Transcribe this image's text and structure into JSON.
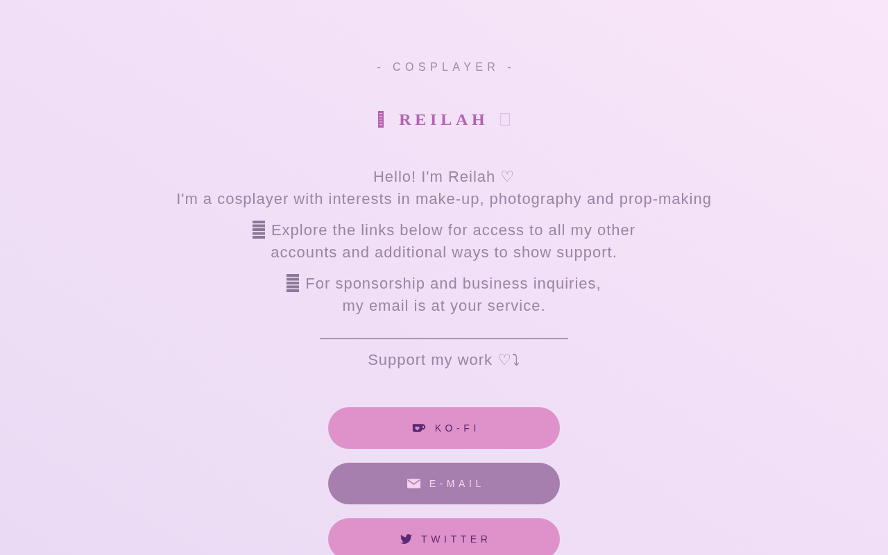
{
  "header": {
    "tagline": "- COSPLAYER -",
    "name": "REILAH"
  },
  "intro": [
    "Hello! I'm Reilah ♡",
    "I'm a cosplayer with interests in make-up, photography and prop-making"
  ],
  "notes": [
    "Explore the links below for access to all my other\naccounts and additional ways to show support.",
    "For sponsorship and business inquiries,\nmy email is at your service."
  ],
  "support_heading": "Support my work ♡⤵",
  "links": [
    {
      "kind": "kofi",
      "label": "KO-FI",
      "color": "#de92c9"
    },
    {
      "kind": "email",
      "label": "E-MAIL",
      "color": "#a67fae"
    },
    {
      "kind": "twitter",
      "label": "TWITTER",
      "color": "#de92c9"
    }
  ]
}
